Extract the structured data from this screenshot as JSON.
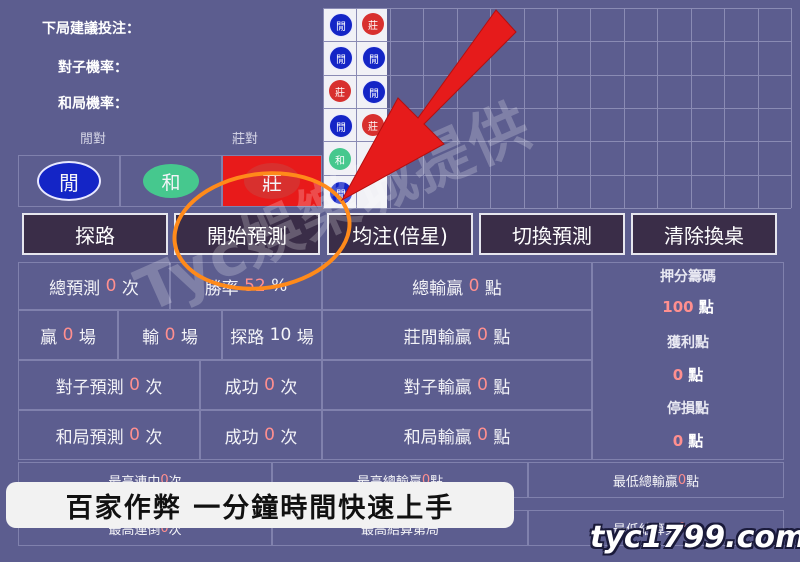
{
  "top_labels": {
    "suggest": "下局建議投注：",
    "pair_rate": "對子機率：",
    "tie_rate": "和局機率："
  },
  "pair_headers": {
    "player": "閒對",
    "banker": "莊對"
  },
  "big_buttons": {
    "player": "閒",
    "tie": "和",
    "banker": "莊"
  },
  "beads": {
    "player": "閒",
    "banker": "莊",
    "tie": "和"
  },
  "buttons": [
    "探路",
    "開始預測",
    "均注(倍星)",
    "切換預測",
    "清除換桌"
  ],
  "stats": {
    "total_predict": {
      "label": "總預測",
      "value": "0",
      "unit": "次"
    },
    "win_rate": {
      "label": "勝率",
      "value": "52",
      "unit": "%"
    },
    "total_win": {
      "label": "總輸贏",
      "value": "0",
      "unit": "點"
    },
    "wins": {
      "label": "贏",
      "value": "0",
      "unit": "場"
    },
    "losses": {
      "label": "輸",
      "value": "0",
      "unit": "場"
    },
    "explore": {
      "label": "探路",
      "value": "10",
      "unit": "場"
    },
    "bp_win": {
      "label": "莊閒輸贏",
      "value": "0",
      "unit": "點"
    },
    "pair_predict": {
      "label": "對子預測",
      "value": "0",
      "unit": "次"
    },
    "pair_success": {
      "label": "成功",
      "value": "0",
      "unit": "次"
    },
    "pair_win": {
      "label": "對子輸贏",
      "value": "0",
      "unit": "點"
    },
    "tie_predict": {
      "label": "和局預測",
      "value": "0",
      "unit": "次"
    },
    "tie_success": {
      "label": "成功",
      "value": "0",
      "unit": "次"
    },
    "tie_win": {
      "label": "和局輸贏",
      "value": "0",
      "unit": "點"
    }
  },
  "side": {
    "bet_header": "押分籌碼",
    "bet_value": "100",
    "bet_unit": "點",
    "profit_header": "獲利點",
    "profit_value": "0",
    "profit_unit": "點",
    "stop_header": "停損點",
    "stop_value": "0",
    "stop_unit": "點"
  },
  "bottom": {
    "max_streak": {
      "label": "最高連中",
      "value": "0",
      "unit": "次"
    },
    "max_total": {
      "label": "最高總輸贏",
      "value": "0",
      "unit": "點"
    },
    "min_total": {
      "label": "最低總輸贏",
      "value": "0",
      "unit": "點"
    },
    "max_lose": {
      "label": "最高連倒",
      "value": "0",
      "unit": "次"
    },
    "max_settle": {
      "label": "最高結算第",
      "value": "",
      "unit": "局"
    },
    "min_settle": {
      "label": "最低結算第",
      "value": "0",
      "unit": "局"
    }
  },
  "watermark": "Tyc娛樂城提供",
  "banner": "百家作弊 一分鐘時間快速上手",
  "site": "tyc1799.com"
}
